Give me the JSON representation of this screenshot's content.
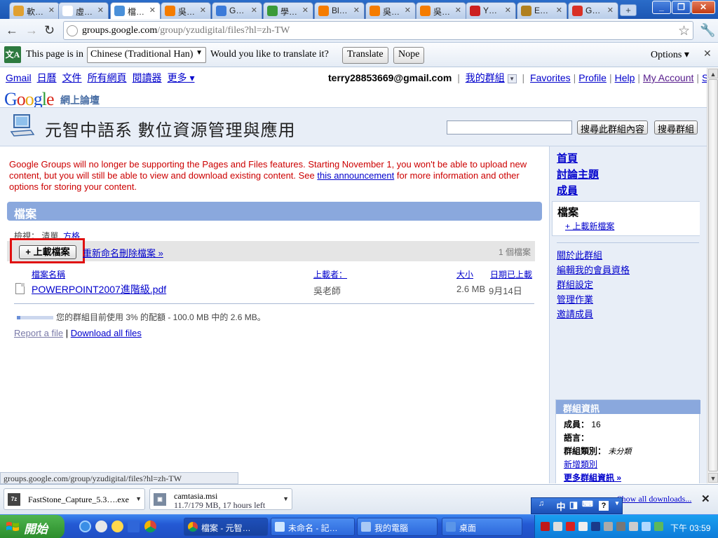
{
  "browser": {
    "tabs": [
      {
        "label": "軟…",
        "icon_color": "#e0a030"
      },
      {
        "label": "虛…",
        "icon_color": "#ffffff"
      },
      {
        "label": "檔…",
        "icon_color": "#4a90d9",
        "active": true
      },
      {
        "label": "吳…",
        "icon_color": "#f57c00"
      },
      {
        "label": "G…",
        "icon_color": "#3b7ad9"
      },
      {
        "label": "學…",
        "icon_color": "#3a9a3a"
      },
      {
        "label": "Bl…",
        "icon_color": "#f57c00"
      },
      {
        "label": "吳…",
        "icon_color": "#f57c00"
      },
      {
        "label": "吳…",
        "icon_color": "#f57c00"
      },
      {
        "label": "Y…",
        "icon_color": "#cc2020"
      },
      {
        "label": "E…",
        "icon_color": "#b08020"
      },
      {
        "label": "G…",
        "icon_color": "#d93025"
      }
    ],
    "url_host": "groups.google.com",
    "url_path": "/group/yzudigital/files?hl=zh-TW"
  },
  "translate_bar": {
    "prefix": "This page is in",
    "language": "Chinese (Traditional Han)",
    "question": "Would you like to translate it?",
    "translate_label": "Translate",
    "nope_label": "Nope",
    "options_label": "Options ▾"
  },
  "gbar": {
    "left_links": [
      "Gmail",
      "日曆",
      "文件",
      "所有網頁",
      "閱讀器",
      "更多 ▾"
    ],
    "email": "terry28853669@gmail.com",
    "my_groups": "我的群組",
    "right_links": [
      "Favorites",
      "Profile",
      "Help",
      "My Account",
      "Sign out"
    ]
  },
  "logo_sub": "網上論壇",
  "group": {
    "title": "元智中語系 數位資源管理與應用",
    "search_group_btn": "搜尋此群組內容",
    "search_groups_btn": "搜尋群組"
  },
  "notice": {
    "part1": "Google Groups will no longer be supporting the Pages and Files features. Starting November 1, you won't be able to upload new content, but you will still be able to view and download existing content. See ",
    "link": "this announcement",
    "part2": " for more information and other options for storing your content."
  },
  "files": {
    "header": "檔案",
    "view_prefix": "檢視： 清單, ",
    "view_link": "方格",
    "upload_btn": "+ 上載檔案",
    "action_link": "重新命名刪除檔案 »",
    "count": "1 個檔案",
    "columns": {
      "name": "檔案名稱",
      "uploader": "上載者：",
      "size": "大小",
      "date": "日期已上載"
    },
    "rows": [
      {
        "name": "POWERPOINT2007進階級.pdf",
        "uploader": "吳老師",
        "size": "2.6 MB",
        "date": "9月14日"
      }
    ],
    "quota_text": "您的群組目前使用 3% 的配額 - 100.0 MB 中的 2.6 MB。",
    "quota_fraction": 0.03,
    "report_link": "Report a file",
    "download_all": "Download all files"
  },
  "sidebar": {
    "nav": [
      "首頁",
      "討論主題",
      "成員"
    ],
    "active": "檔案",
    "active_sub": "+ 上載新檔案",
    "links": [
      "關於此群組",
      "編輯我的會員資格",
      "群組設定",
      "管理作業",
      "邀請成員"
    ],
    "info_header": "群組資訊",
    "members_label": "成員：",
    "members_value": "16",
    "language_label": "語言：",
    "category_label": "群組類別：",
    "category_value": "未分類",
    "add_category": "新增類別",
    "more_info": "更多群組資訊 »"
  },
  "status_url": "groups.google.com/group/yzudigital/files?hl=zh-TW",
  "downloads": [
    {
      "name": "FastStone_Capture_5.3….exe",
      "progress": "",
      "icon": "7z"
    },
    {
      "name": "camtasia.msi",
      "progress": "11.7/179 MB, 17 hours left",
      "icon": "msi"
    }
  ],
  "show_all_downloads": "Show all downloads...",
  "ime": [
    "中",
    "◨",
    "⌨",
    "?"
  ],
  "taskbar": {
    "start": "開始",
    "tasks": [
      "檔案 - 元智…",
      "未命名 - 記…",
      "我的電腦",
      "桌面"
    ],
    "clock": "下午 03:59"
  }
}
